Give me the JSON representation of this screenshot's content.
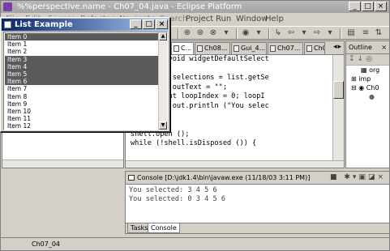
{
  "eclipse": {
    "title": "%%perspective.name - Ch07_04.java - Eclipse Platform",
    "menu": [
      "File",
      "Edit",
      "Source",
      "Refactor",
      "Navigate",
      "Search",
      "Project",
      "Run",
      "Window",
      "Help"
    ],
    "editor_tabs": [
      "C...",
      "Ch08...",
      "Gui_4...",
      "Ch07...",
      "Ch07..."
    ],
    "code_lines": [
      "",
      "  public void widgetDefaultSelect",
      "  {",
      "   int [] selections = list.getSe",
      "   String outText = \"\";",
      "   for (int loopIndex = 0; loopI",
      "   System.out.println (\"You selec",
      "  }",
      "});",
      "",
      "shell.open ();",
      "while (!shell.isDisposed ()) {"
    ],
    "outline": {
      "tab_label": "Outline",
      "items": [
        "org",
        "imp",
        "Ch0",
        ""
      ]
    },
    "console": {
      "header": "Console [D:\\jdk1.4\\bin\\javaw.exe (11/18/03 3:11 PM)]",
      "lines": [
        "You selected: 3 4 5 6",
        "You selected: 0 3 4 5 6"
      ],
      "tabs": [
        "Tasks",
        "Console"
      ]
    },
    "status": "Ch07_04"
  },
  "list_window": {
    "title": "List Example",
    "items": [
      {
        "label": "Item 0",
        "selected": true
      },
      {
        "label": "Item 1",
        "selected": false
      },
      {
        "label": "Item 2",
        "selected": false
      },
      {
        "label": "Item 3",
        "selected": true
      },
      {
        "label": "Item 4",
        "selected": true
      },
      {
        "label": "Item 5",
        "selected": true
      },
      {
        "label": "Item 6",
        "selected": true
      },
      {
        "label": "Item 7",
        "selected": false
      },
      {
        "label": "Item 8",
        "selected": false
      },
      {
        "label": "Item 9",
        "selected": false
      },
      {
        "label": "Item 10",
        "selected": false
      },
      {
        "label": "Item 11",
        "selected": false
      },
      {
        "label": "Item 12",
        "selected": false
      }
    ]
  },
  "colors": {
    "list_selection": "#5a5a5a",
    "active_titlebar": "#0a246a",
    "inactive_titlebar": "#a4a4a4",
    "keyword": "#7f0055"
  }
}
